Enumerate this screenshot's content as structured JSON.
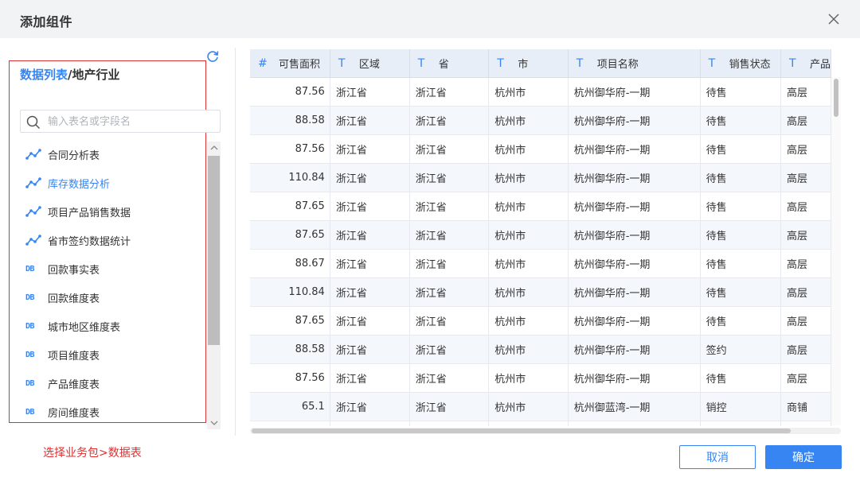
{
  "dialog": {
    "title": "添加组件",
    "cancel_label": "取消",
    "ok_label": "确定"
  },
  "left": {
    "breadcrumb_root": "数据列表",
    "breadcrumb_sep": "/",
    "breadcrumb_current": "地产行业",
    "search_placeholder": "输入表名或字段名",
    "items": [
      {
        "label": "合同分析表",
        "icon": "analysis-icon"
      },
      {
        "label": "库存数据分析",
        "icon": "analysis-icon",
        "active": true
      },
      {
        "label": "项目产品销售数据",
        "icon": "analysis-icon"
      },
      {
        "label": "省市签约数据统计",
        "icon": "analysis-icon"
      },
      {
        "label": "回款事实表",
        "icon": "db-icon",
        "icon_text": "DB"
      },
      {
        "label": "回款维度表",
        "icon": "db-icon",
        "icon_text": "DB"
      },
      {
        "label": "城市地区维度表",
        "icon": "db-icon",
        "icon_text": "DB"
      },
      {
        "label": "项目维度表",
        "icon": "db-icon",
        "icon_text": "DB"
      },
      {
        "label": "产品维度表",
        "icon": "db-icon",
        "icon_text": "DB"
      },
      {
        "label": "房间维度表",
        "icon": "db-icon",
        "icon_text": "DB"
      }
    ],
    "hint": "选择业务包>数据表"
  },
  "table": {
    "columns": [
      {
        "type_icon": "#",
        "name": "可售面积"
      },
      {
        "type_icon": "T",
        "name": "区域"
      },
      {
        "type_icon": "T",
        "name": "省"
      },
      {
        "type_icon": "T",
        "name": "市"
      },
      {
        "type_icon": "T",
        "name": "项目名称"
      },
      {
        "type_icon": "T",
        "name": "销售状态"
      },
      {
        "type_icon": "T",
        "name": "产品"
      }
    ],
    "rows": [
      [
        "87.56",
        "浙江省",
        "浙江省",
        "杭州市",
        "杭州御华府-一期",
        "待售",
        "高层"
      ],
      [
        "88.58",
        "浙江省",
        "浙江省",
        "杭州市",
        "杭州御华府-一期",
        "待售",
        "高层"
      ],
      [
        "87.56",
        "浙江省",
        "浙江省",
        "杭州市",
        "杭州御华府-一期",
        "待售",
        "高层"
      ],
      [
        "110.84",
        "浙江省",
        "浙江省",
        "杭州市",
        "杭州御华府-一期",
        "待售",
        "高层"
      ],
      [
        "87.65",
        "浙江省",
        "浙江省",
        "杭州市",
        "杭州御华府-一期",
        "待售",
        "高层"
      ],
      [
        "87.65",
        "浙江省",
        "浙江省",
        "杭州市",
        "杭州御华府-一期",
        "待售",
        "高层"
      ],
      [
        "88.67",
        "浙江省",
        "浙江省",
        "杭州市",
        "杭州御华府-一期",
        "待售",
        "高层"
      ],
      [
        "110.84",
        "浙江省",
        "浙江省",
        "杭州市",
        "杭州御华府-一期",
        "待售",
        "高层"
      ],
      [
        "87.65",
        "浙江省",
        "浙江省",
        "杭州市",
        "杭州御华府-一期",
        "待售",
        "高层"
      ],
      [
        "88.58",
        "浙江省",
        "浙江省",
        "杭州市",
        "杭州御华府-一期",
        "签约",
        "高层"
      ],
      [
        "87.56",
        "浙江省",
        "浙江省",
        "杭州市",
        "杭州御华府-一期",
        "待售",
        "高层"
      ],
      [
        "65.1",
        "浙江省",
        "浙江省",
        "杭州市",
        "杭州御蓝湾-一期",
        "销控",
        "商铺"
      ],
      [
        "",
        "",
        "",
        "",
        "",
        "",
        ""
      ]
    ]
  },
  "colors": {
    "accent": "#3685f2",
    "highlight_border": "#e02f2f",
    "header_bg": "#e8eef8"
  }
}
